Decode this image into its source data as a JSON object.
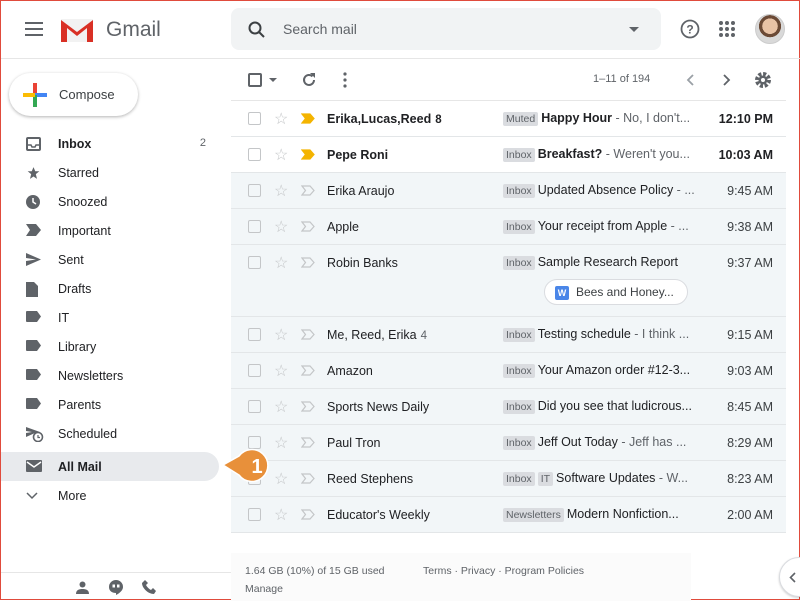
{
  "header": {
    "brand": "Gmail",
    "search_placeholder": "Search mail"
  },
  "compose": {
    "label": "Compose"
  },
  "nav": [
    {
      "label": "Inbox",
      "icon": "inbox-icon",
      "count": "2",
      "bold": true
    },
    {
      "label": "Starred",
      "icon": "star-icon"
    },
    {
      "label": "Snoozed",
      "icon": "clock-icon"
    },
    {
      "label": "Important",
      "icon": "important-icon"
    },
    {
      "label": "Sent",
      "icon": "send-icon"
    },
    {
      "label": "Drafts",
      "icon": "draft-icon"
    },
    {
      "label": "IT",
      "icon": "label-icon"
    },
    {
      "label": "Library",
      "icon": "label-icon"
    },
    {
      "label": "Newsletters",
      "icon": "label-icon"
    },
    {
      "label": "Parents",
      "icon": "label-icon"
    },
    {
      "label": "Scheduled",
      "icon": "scheduled-icon"
    },
    {
      "label": "All Mail",
      "icon": "mail-icon",
      "active": true,
      "bold": true
    },
    {
      "label": "More",
      "icon": "chevron-down-icon"
    }
  ],
  "toolbar": {
    "pagination": "1–11 of 194"
  },
  "emails": [
    {
      "sender": "Erika,Lucas,Reed",
      "count": "8",
      "tags": [
        "Muted"
      ],
      "subject": "Happy Hour",
      "snippet": "No, I don't...",
      "time": "12:10 PM",
      "unread": true,
      "important": true
    },
    {
      "sender": "Pepe Roni",
      "tags": [
        "Inbox"
      ],
      "subject": "Breakfast?",
      "snippet": "Weren't you...",
      "time": "10:03 AM",
      "unread": true,
      "important": true
    },
    {
      "sender": "Erika Araujo",
      "tags": [
        "Inbox"
      ],
      "subject": "Updated Absence Policy",
      "snippet": "...",
      "time": "9:45 AM"
    },
    {
      "sender": "Apple",
      "tags": [
        "Inbox"
      ],
      "subject": "Your receipt from Apple",
      "snippet": "...",
      "time": "9:38 AM"
    },
    {
      "sender": "Robin Banks",
      "tags": [
        "Inbox"
      ],
      "subject": "Sample Research Report",
      "snippet": "",
      "time": "9:37 AM",
      "attachment": "Bees and Honey..."
    },
    {
      "sender": "Me, Reed, Erika",
      "count": "4",
      "tags": [
        "Inbox"
      ],
      "subject": "Testing schedule",
      "snippet": "I think ...",
      "time": "9:15 AM"
    },
    {
      "sender": "Amazon",
      "tags": [
        "Inbox"
      ],
      "subject": "Your Amazon order #12-3...",
      "snippet": "",
      "time": "9:03 AM"
    },
    {
      "sender": "Sports News Daily",
      "tags": [
        "Inbox"
      ],
      "subject": "Did you see that ludicrous...",
      "snippet": "",
      "time": "8:45 AM"
    },
    {
      "sender": "Paul Tron",
      "tags": [
        "Inbox"
      ],
      "subject": "Jeff Out Today",
      "snippet": "Jeff has ...",
      "time": "8:29 AM"
    },
    {
      "sender": "Reed Stephens",
      "tags": [
        "Inbox",
        "IT"
      ],
      "subject": "Software Updates",
      "snippet": "W...",
      "time": "8:23 AM"
    },
    {
      "sender": "Educator's Weekly",
      "tags": [
        "Newsletters"
      ],
      "subject": "Modern Nonfiction...",
      "snippet": "",
      "time": "2:00 AM"
    }
  ],
  "footer": {
    "storage": "1.64 GB (10%) of 15 GB used",
    "manage": "Manage",
    "links": "Terms · Privacy · Program Policies"
  },
  "callout": {
    "number": "1",
    "color": "#e8903a"
  },
  "colors": {
    "important": "#f4b400",
    "gmail_red": "#d93025"
  }
}
